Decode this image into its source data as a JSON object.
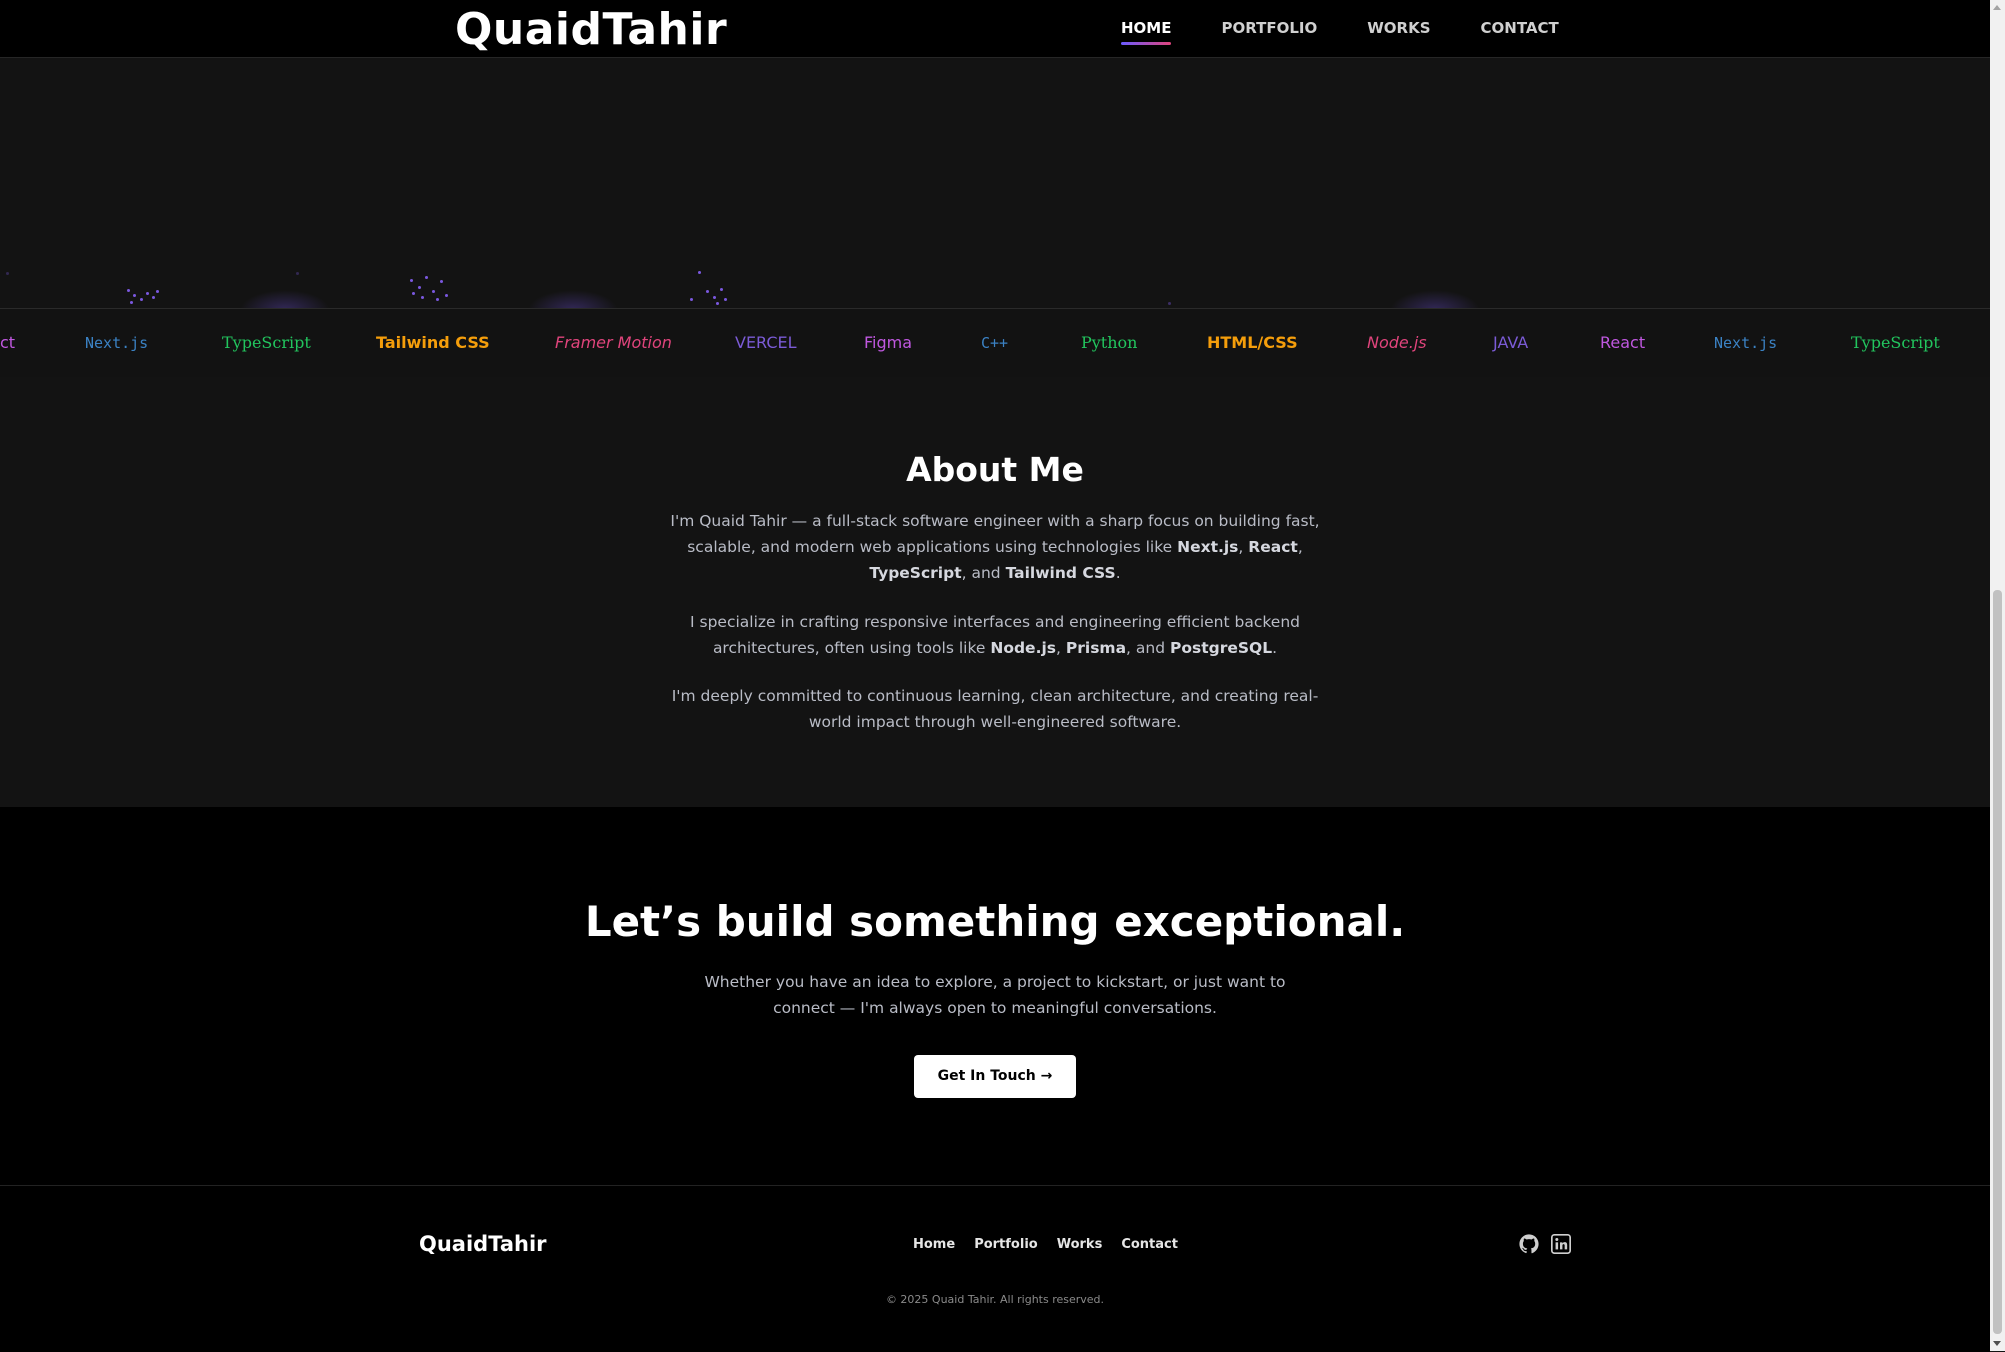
{
  "header": {
    "logo": "QuaidTahir",
    "nav": [
      {
        "label": "HOME",
        "active": true
      },
      {
        "label": "PORTFOLIO",
        "active": false
      },
      {
        "label": "WORKS",
        "active": false
      },
      {
        "label": "CONTACT",
        "active": false
      }
    ]
  },
  "tech_marquee": [
    {
      "label": "ct",
      "color": "#c058e0"
    },
    {
      "label": "Next.js",
      "color": "#3b82c4"
    },
    {
      "label": "TypeScript",
      "color": "#22c55e"
    },
    {
      "label": "Tailwind CSS",
      "color": "#f59e0b"
    },
    {
      "label": "Framer Motion",
      "color": "#e0447c"
    },
    {
      "label": "VERCEL",
      "color": "#7b5bd6"
    },
    {
      "label": "Figma",
      "color": "#c058e0"
    },
    {
      "label": "C++",
      "color": "#3b82c4"
    },
    {
      "label": "Python",
      "color": "#22c55e"
    },
    {
      "label": "HTML/CSS",
      "color": "#f59e0b"
    },
    {
      "label": "Node.js",
      "color": "#e0447c"
    },
    {
      "label": "JAVA",
      "color": "#7b5bd6"
    },
    {
      "label": "React",
      "color": "#c058e0"
    },
    {
      "label": "Next.js",
      "color": "#3b82c4"
    },
    {
      "label": "TypeScript",
      "color": "#22c55e"
    }
  ],
  "about": {
    "title": "About Me",
    "p1": {
      "intro": "I'm Quaid Tahir — a full-stack software engineer with a sharp focus on building fast, scalable, and modern web applications using technologies like",
      "t1": "Next.js",
      "s1": ",",
      "t2": "React",
      "s2": ",",
      "t3": "TypeScript",
      "s3": ", and",
      "t4": "Tailwind CSS",
      "end": "."
    },
    "p2": {
      "intro": "I specialize in crafting responsive interfaces and engineering efficient backend architectures, often using tools like",
      "t1": "Node.js",
      "s1": ",",
      "t2": "Prisma",
      "s2": ", and",
      "t3": "PostgreSQL",
      "end": "."
    },
    "p3": "I'm deeply committed to continuous learning, clean architecture, and creating real-world impact through well-engineered software."
  },
  "cta": {
    "title": "Let’s build something exceptional.",
    "text": "Whether you have an idea to explore, a project to kickstart, or just want to connect — I'm always open to meaningful conversations.",
    "button": "Get In Touch →"
  },
  "footer": {
    "logo": "QuaidTahir",
    "nav": [
      "Home",
      "Portfolio",
      "Works",
      "Contact"
    ],
    "icons": [
      "github-icon",
      "linkedin-icon"
    ],
    "copyright": "© 2025 Quaid Tahir. All rights reserved."
  }
}
